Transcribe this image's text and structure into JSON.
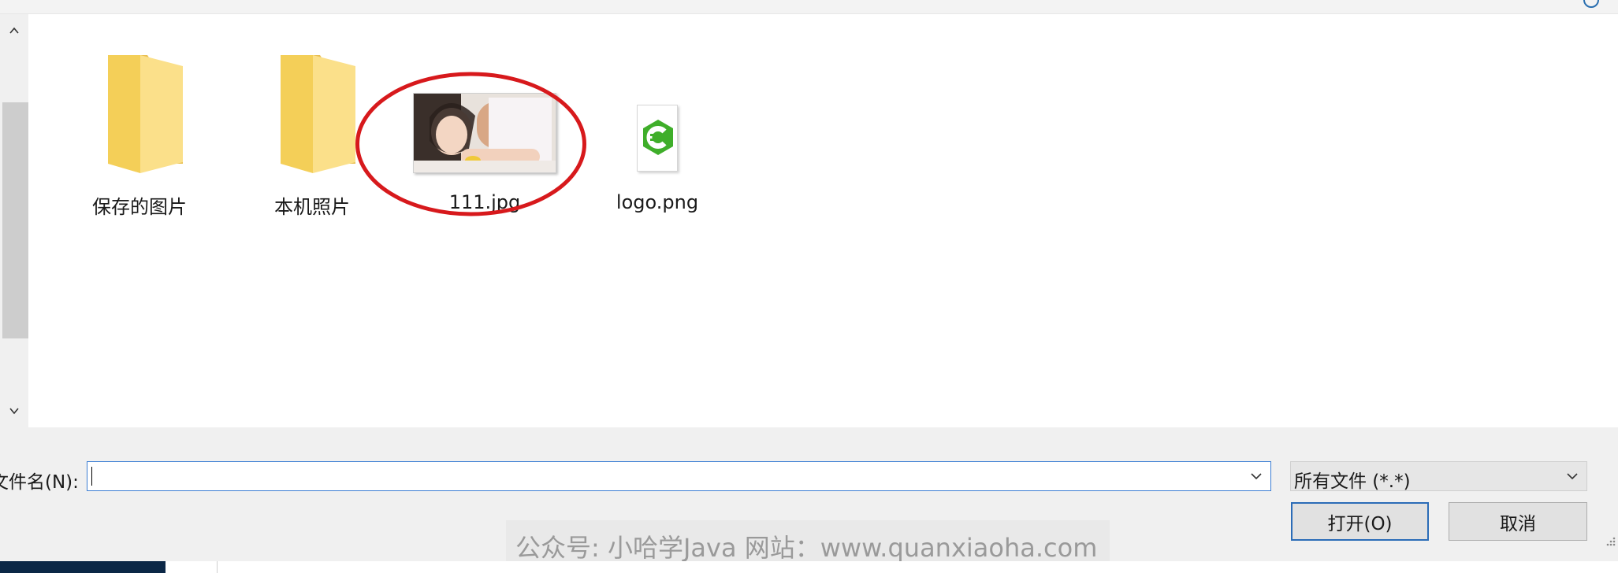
{
  "files": [
    {
      "name": "保存的图片",
      "type": "folder",
      "icon": "folder-icon"
    },
    {
      "name": "本机照片",
      "type": "folder",
      "icon": "folder-icon"
    },
    {
      "name": "111.jpg",
      "type": "image",
      "icon": "photo-thumbnail",
      "highlighted": true
    },
    {
      "name": "logo.png",
      "type": "image",
      "icon": "logo-thumbnail"
    }
  ],
  "bottom": {
    "filename_label": "文件名(N):",
    "filename_value": "",
    "filetype_selected": "所有文件 (*.*)",
    "open_label": "打开(O)",
    "cancel_label": "取消"
  },
  "watermark": "公众号: 小哈学Java  网站：www.quanxiaoha.com",
  "colors": {
    "folder": "#f7d86a",
    "highlight_ellipse": "#d7191c",
    "logo_green": "#3fae2a",
    "focus_border": "#3b7dd3"
  }
}
